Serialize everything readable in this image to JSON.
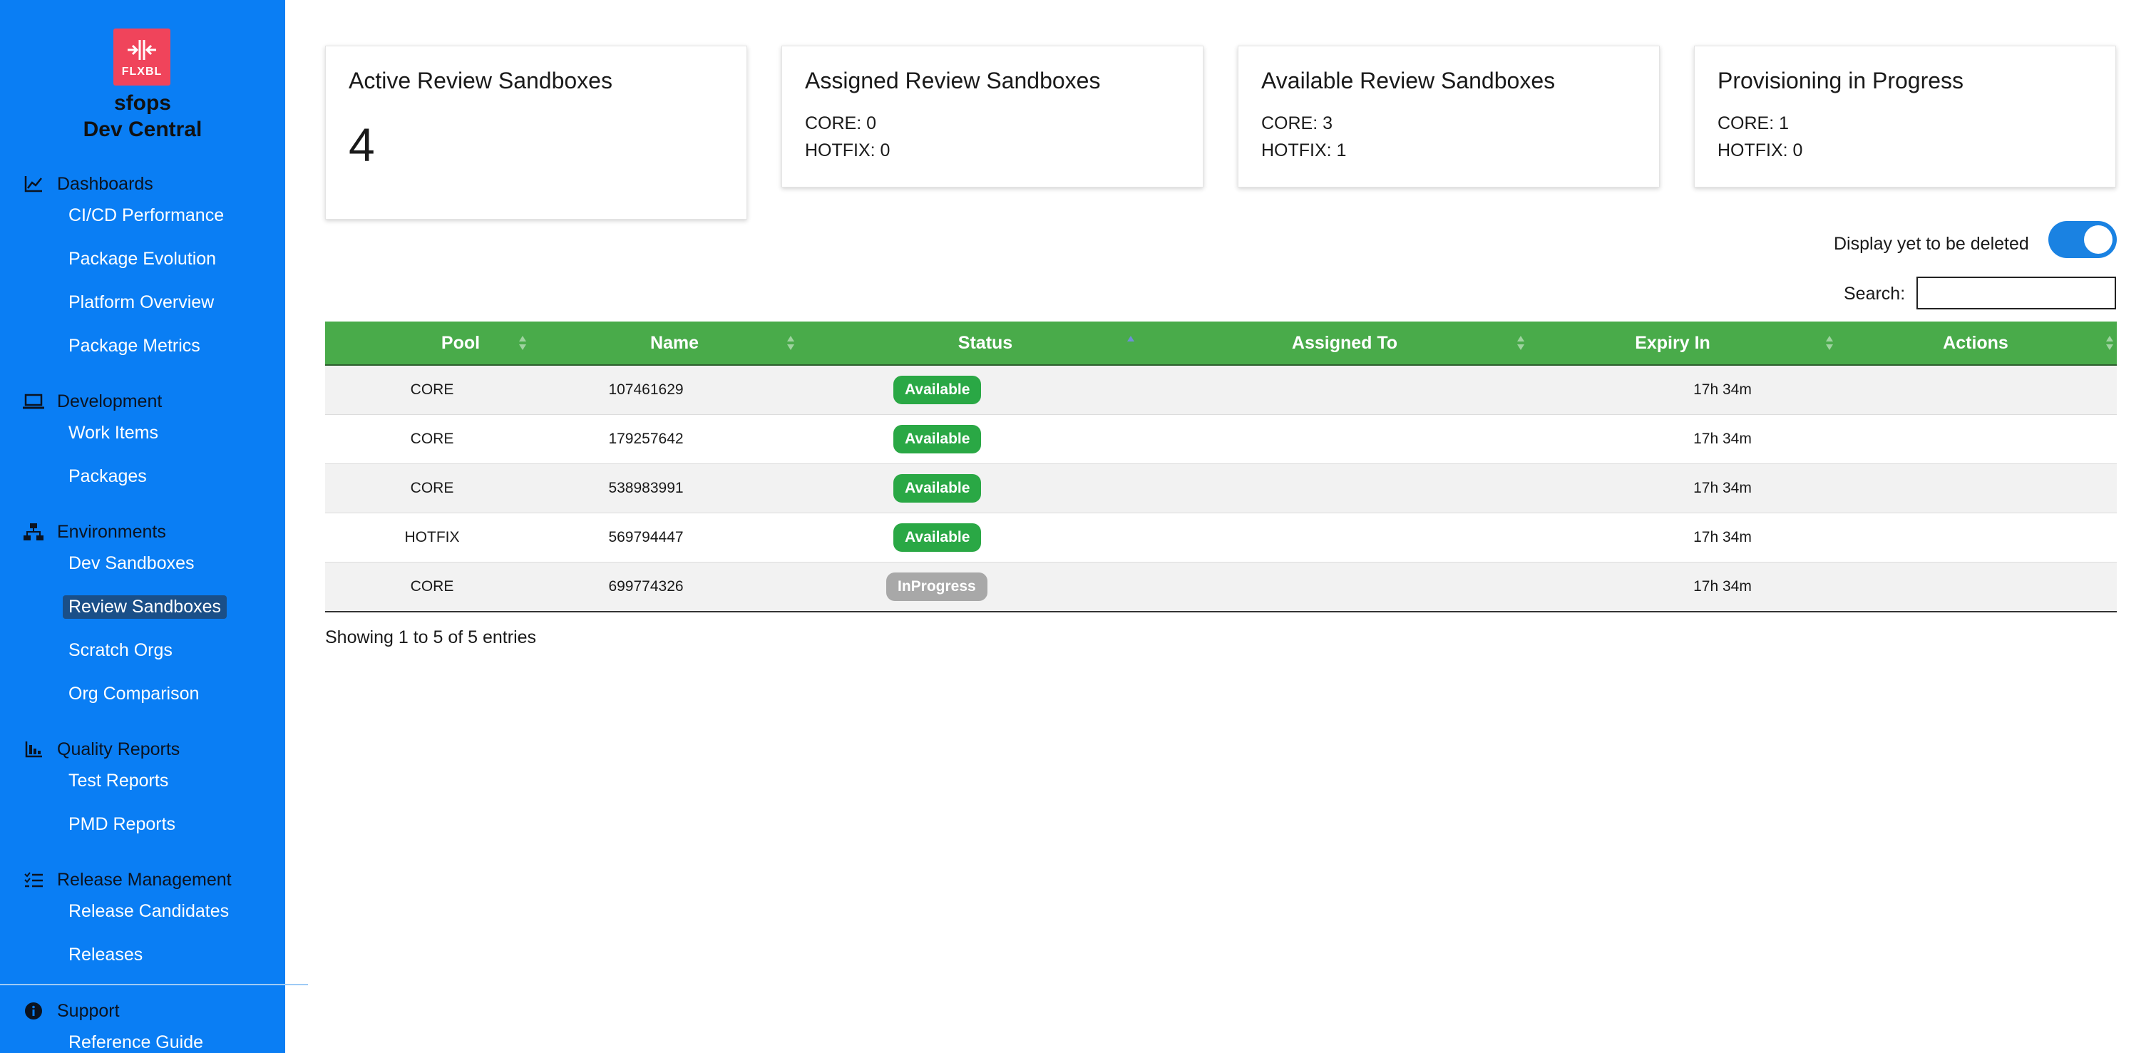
{
  "brand": {
    "logo_text": "FLXBL",
    "name_line1": "sfops",
    "name_line2": "Dev Central"
  },
  "sidebar": {
    "sections": [
      {
        "title": "Dashboards",
        "icon": "chart-line-icon",
        "items": [
          "CI/CD Performance",
          "Package Evolution",
          "Platform Overview",
          "Package Metrics"
        ]
      },
      {
        "title": "Development",
        "icon": "laptop-icon",
        "items": [
          "Work Items",
          "Packages"
        ]
      },
      {
        "title": "Environments",
        "icon": "network-icon",
        "items": [
          "Dev Sandboxes",
          "Review Sandboxes",
          "Scratch Orgs",
          "Org Comparison"
        ]
      },
      {
        "title": "Quality Reports",
        "icon": "bar-chart-icon",
        "items": [
          "Test Reports",
          "PMD Reports"
        ]
      },
      {
        "title": "Release Management",
        "icon": "checklist-icon",
        "items": [
          "Release Candidates",
          "Releases"
        ]
      },
      {
        "title": "Support",
        "icon": "info-icon",
        "items": [
          "Reference Guide"
        ]
      }
    ],
    "active_item": "Review Sandboxes"
  },
  "cards": {
    "active": {
      "title": "Active Review Sandboxes",
      "value": "4"
    },
    "assigned": {
      "title": "Assigned Review Sandboxes",
      "line1": "CORE: 0",
      "line2": "HOTFIX: 0"
    },
    "available": {
      "title": "Available Review Sandboxes",
      "line1": "CORE: 3",
      "line2": "HOTFIX: 1"
    },
    "provisioning": {
      "title": "Provisioning in Progress",
      "line1": "CORE: 1",
      "line2": "HOTFIX: 0"
    }
  },
  "controls": {
    "toggle_label": "Display yet to be deleted",
    "toggle_on": true,
    "search_label": "Search:",
    "search_value": ""
  },
  "table": {
    "columns": [
      "Pool",
      "Name",
      "Status",
      "Assigned To",
      "Expiry In",
      "Actions"
    ],
    "rows": [
      {
        "pool": "CORE",
        "name": "107461629",
        "status": "Available",
        "assigned_to": "",
        "expiry": "17h 34m",
        "actions": ""
      },
      {
        "pool": "CORE",
        "name": "179257642",
        "status": "Available",
        "assigned_to": "",
        "expiry": "17h 34m",
        "actions": ""
      },
      {
        "pool": "CORE",
        "name": "538983991",
        "status": "Available",
        "assigned_to": "",
        "expiry": "17h 34m",
        "actions": ""
      },
      {
        "pool": "HOTFIX",
        "name": "569794447",
        "status": "Available",
        "assigned_to": "",
        "expiry": "17h 34m",
        "actions": ""
      },
      {
        "pool": "CORE",
        "name": "699774326",
        "status": "InProgress",
        "assigned_to": "",
        "expiry": "17h 34m",
        "actions": ""
      }
    ],
    "footer": "Showing 1 to 5 of 5 entries"
  },
  "colors": {
    "sidebar_bg": "#0a7ef4",
    "logo_bg": "#f0445b",
    "table_header": "#49ab4a",
    "badge_available": "#2aa845",
    "badge_inprogress": "#a8a8a8",
    "toggle_on": "#1a82e2"
  }
}
